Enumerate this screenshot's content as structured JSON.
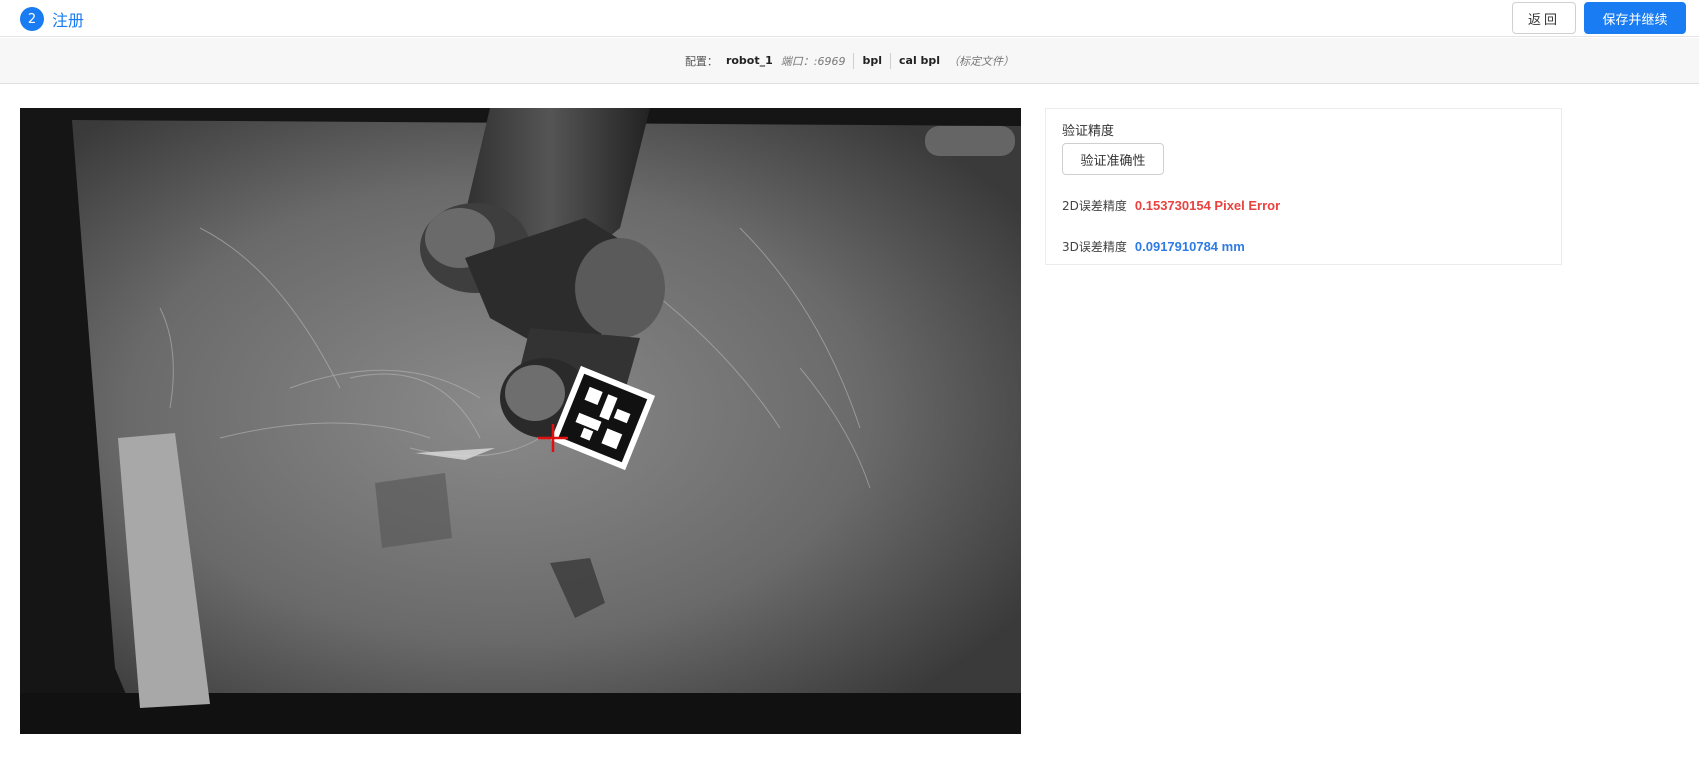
{
  "header": {
    "step_number": "2",
    "step_title": "注册",
    "back_label": "返回",
    "save_label": "保存并继续",
    "accent_color": "#1a7cf2"
  },
  "config_bar": {
    "label": "配置：",
    "robot": "robot_1",
    "port": "端口：:6969",
    "bpl": "bpl",
    "cal": "cal bpl",
    "file_note": "（标定文件）"
  },
  "camera_view": {
    "marker": "red-crosshair-icon"
  },
  "accuracy_panel": {
    "title": "验证精度",
    "verify_button": "验证准确性",
    "error_2d_label": "2D误差精度",
    "error_2d_value": "0.153730154 Pixel Error",
    "error_3d_label": "3D误差精度",
    "error_3d_value": "0.0917910784 mm",
    "error_2d_color": "#e8433f",
    "error_3d_color": "#2f7be5"
  }
}
